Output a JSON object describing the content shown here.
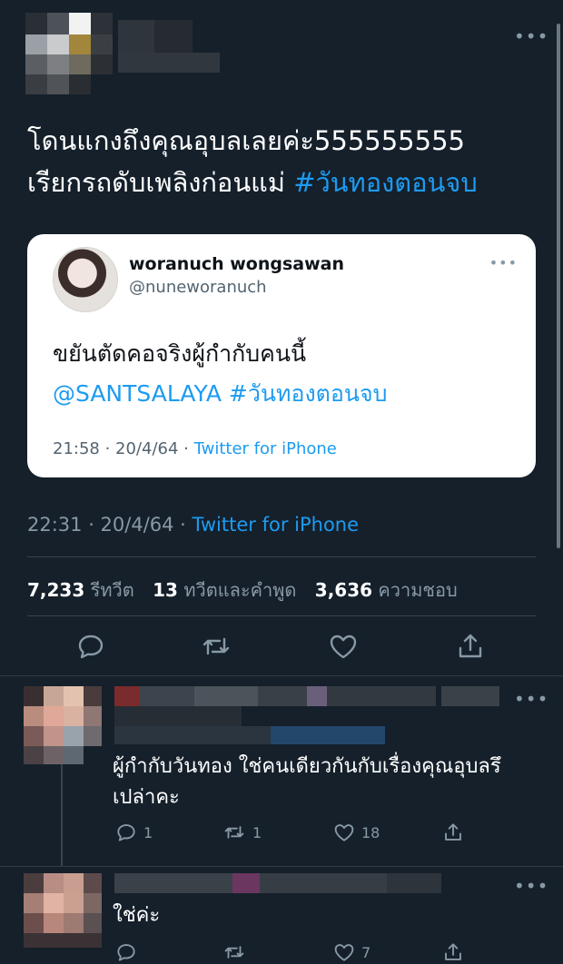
{
  "main_tweet": {
    "text_line1": "โดนแกงถึงคุณอุบลเลยค่ะ555555555",
    "text_line2": "เรียกรถดับเพลิงก่อนแม่ ",
    "hashtag": "#วันทองตอนจบ",
    "time": "22:31 · 20/4/64 · ",
    "client": "Twitter for iPhone",
    "stats": {
      "retweets_count": "7,233",
      "retweets_label": "รีทวีต",
      "quotes_count": "13",
      "quotes_label": "ทวีตและคำพูด",
      "likes_count": "3,636",
      "likes_label": "ความชอบ"
    }
  },
  "quoted_tweet": {
    "name": "woranuch wongsawan",
    "handle": "@nuneworanuch",
    "text_line1": "ขยันตัดคอจริงผู้กำกับคนนี้",
    "mention": "@SANTSALAYA",
    "hashtag": " #วันทองตอนจบ",
    "time": "21:58 · 20/4/64 · ",
    "client": "Twitter for iPhone"
  },
  "replies": [
    {
      "text_line1": "ผู้กำกับวันทอง ใช่คนเดียวกันกับเรื่องคุณอุบลรึ",
      "text_line2": "เปล่าคะ",
      "reply_count": "1",
      "retweet_count": "1",
      "like_count": "18"
    },
    {
      "text_line1": "ใช่ค่ะ",
      "reply_count": "",
      "retweet_count": "",
      "like_count": "7"
    }
  ],
  "icons": {
    "reply": "reply-icon",
    "retweet": "retweet-icon",
    "like": "heart-icon",
    "share": "share-icon",
    "more": "more-icon"
  },
  "colors": {
    "background": "#15202b",
    "link": "#1d9bf0",
    "muted": "#8899a6"
  }
}
